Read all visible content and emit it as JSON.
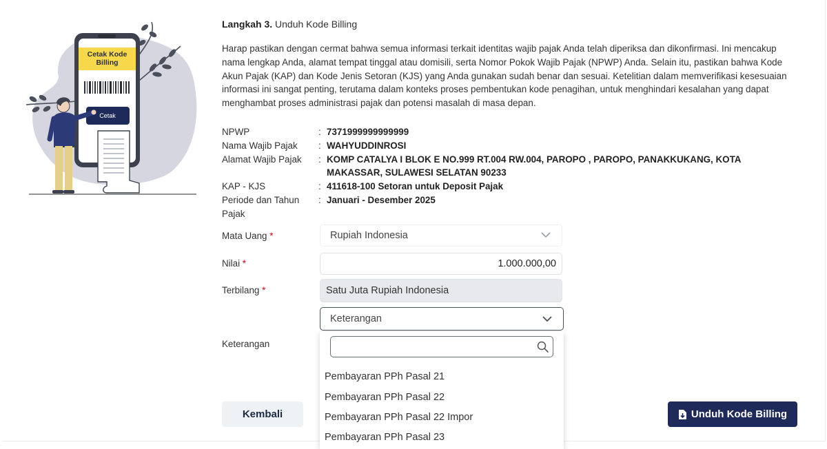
{
  "illustration": {
    "card_title_line1": "Cetak Kode",
    "card_title_line2": "Billing",
    "button_label": "Cetak"
  },
  "step": {
    "number": "Langkah 3.",
    "title": "Unduh Kode Billing"
  },
  "description": "Harap pastikan dengan cermat bahwa semua informasi terkait identitas wajib pajak Anda telah diperiksa dan dikonfirmasi. Ini mencakup nama lengkap Anda, alamat tempat tinggal atau domisili, serta Nomor Pokok Wajib Pajak (NPWP) Anda. Selain itu, pastikan bahwa Kode Akun Pajak (KAP) dan Kode Jenis Setoran (KJS) yang Anda gunakan sudah benar dan sesuai. Ketelitian dalam memverifikasi kesesuaian informasi ini sangat penting, terutama dalam konteks proses pembentukan kode penagihan, untuk menghindari kesalahan yang dapat menghambat proses administrasi pajak dan potensi masalah di masa depan.",
  "info": [
    {
      "label": "NPWP",
      "value": "7371999999999999"
    },
    {
      "label": "Nama Wajib Pajak",
      "value": "WAHYUDDINROSI"
    },
    {
      "label": "Alamat Wajib Pajak",
      "value": "KOMP CATALYA I BLOK E NO.999 RT.004 RW.004, PAROPO , PAROPO, PANAKKUKANG, KOTA MAKASSAR, SULAWESI SELATAN 90233"
    },
    {
      "label": "KAP - KJS",
      "value": "411618-100 Setoran untuk Deposit Pajak"
    },
    {
      "label": "Periode dan Tahun Pajak",
      "value": "Januari - Desember 2025"
    }
  ],
  "form": {
    "separator": ":",
    "required_mark": "*",
    "mata_uang": {
      "label": "Mata Uang",
      "value": "Rupiah Indonesia"
    },
    "nilai": {
      "label": "Nilai",
      "value": "1.000.000,00"
    },
    "terbilang": {
      "label": "Terbilang",
      "value": "Satu Juta Rupiah Indonesia"
    },
    "keterangan": {
      "label": "Keterangan",
      "placeholder": "Keterangan",
      "search_value": "",
      "options": [
        "Pembayaran PPh Pasal 21",
        "Pembayaran PPh Pasal 22",
        "Pembayaran PPh Pasal 22 Impor",
        "Pembayaran PPh Pasal 23"
      ]
    }
  },
  "buttons": {
    "back": "Kembali",
    "download": "Unduh Kode Billing"
  },
  "colors": {
    "primary": "#1e2a5a",
    "accent_yellow": "#f6d84a",
    "required": "#d0021b",
    "blob": "#d5d6e0"
  }
}
